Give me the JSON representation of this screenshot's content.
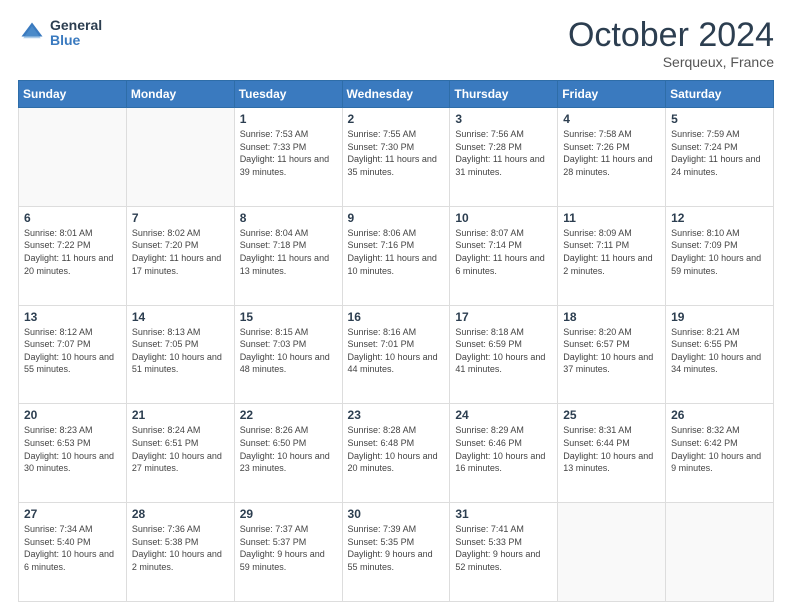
{
  "header": {
    "logo_line1": "General",
    "logo_line2": "Blue",
    "month": "October 2024",
    "location": "Serqueux, France"
  },
  "days_of_week": [
    "Sunday",
    "Monday",
    "Tuesday",
    "Wednesday",
    "Thursday",
    "Friday",
    "Saturday"
  ],
  "weeks": [
    [
      {
        "day": "",
        "sunrise": "",
        "sunset": "",
        "daylight": "",
        "empty": true
      },
      {
        "day": "",
        "sunrise": "",
        "sunset": "",
        "daylight": "",
        "empty": true
      },
      {
        "day": "1",
        "sunrise": "Sunrise: 7:53 AM",
        "sunset": "Sunset: 7:33 PM",
        "daylight": "Daylight: 11 hours and 39 minutes."
      },
      {
        "day": "2",
        "sunrise": "Sunrise: 7:55 AM",
        "sunset": "Sunset: 7:30 PM",
        "daylight": "Daylight: 11 hours and 35 minutes."
      },
      {
        "day": "3",
        "sunrise": "Sunrise: 7:56 AM",
        "sunset": "Sunset: 7:28 PM",
        "daylight": "Daylight: 11 hours and 31 minutes."
      },
      {
        "day": "4",
        "sunrise": "Sunrise: 7:58 AM",
        "sunset": "Sunset: 7:26 PM",
        "daylight": "Daylight: 11 hours and 28 minutes."
      },
      {
        "day": "5",
        "sunrise": "Sunrise: 7:59 AM",
        "sunset": "Sunset: 7:24 PM",
        "daylight": "Daylight: 11 hours and 24 minutes."
      }
    ],
    [
      {
        "day": "6",
        "sunrise": "Sunrise: 8:01 AM",
        "sunset": "Sunset: 7:22 PM",
        "daylight": "Daylight: 11 hours and 20 minutes."
      },
      {
        "day": "7",
        "sunrise": "Sunrise: 8:02 AM",
        "sunset": "Sunset: 7:20 PM",
        "daylight": "Daylight: 11 hours and 17 minutes."
      },
      {
        "day": "8",
        "sunrise": "Sunrise: 8:04 AM",
        "sunset": "Sunset: 7:18 PM",
        "daylight": "Daylight: 11 hours and 13 minutes."
      },
      {
        "day": "9",
        "sunrise": "Sunrise: 8:06 AM",
        "sunset": "Sunset: 7:16 PM",
        "daylight": "Daylight: 11 hours and 10 minutes."
      },
      {
        "day": "10",
        "sunrise": "Sunrise: 8:07 AM",
        "sunset": "Sunset: 7:14 PM",
        "daylight": "Daylight: 11 hours and 6 minutes."
      },
      {
        "day": "11",
        "sunrise": "Sunrise: 8:09 AM",
        "sunset": "Sunset: 7:11 PM",
        "daylight": "Daylight: 11 hours and 2 minutes."
      },
      {
        "day": "12",
        "sunrise": "Sunrise: 8:10 AM",
        "sunset": "Sunset: 7:09 PM",
        "daylight": "Daylight: 10 hours and 59 minutes."
      }
    ],
    [
      {
        "day": "13",
        "sunrise": "Sunrise: 8:12 AM",
        "sunset": "Sunset: 7:07 PM",
        "daylight": "Daylight: 10 hours and 55 minutes."
      },
      {
        "day": "14",
        "sunrise": "Sunrise: 8:13 AM",
        "sunset": "Sunset: 7:05 PM",
        "daylight": "Daylight: 10 hours and 51 minutes."
      },
      {
        "day": "15",
        "sunrise": "Sunrise: 8:15 AM",
        "sunset": "Sunset: 7:03 PM",
        "daylight": "Daylight: 10 hours and 48 minutes."
      },
      {
        "day": "16",
        "sunrise": "Sunrise: 8:16 AM",
        "sunset": "Sunset: 7:01 PM",
        "daylight": "Daylight: 10 hours and 44 minutes."
      },
      {
        "day": "17",
        "sunrise": "Sunrise: 8:18 AM",
        "sunset": "Sunset: 6:59 PM",
        "daylight": "Daylight: 10 hours and 41 minutes."
      },
      {
        "day": "18",
        "sunrise": "Sunrise: 8:20 AM",
        "sunset": "Sunset: 6:57 PM",
        "daylight": "Daylight: 10 hours and 37 minutes."
      },
      {
        "day": "19",
        "sunrise": "Sunrise: 8:21 AM",
        "sunset": "Sunset: 6:55 PM",
        "daylight": "Daylight: 10 hours and 34 minutes."
      }
    ],
    [
      {
        "day": "20",
        "sunrise": "Sunrise: 8:23 AM",
        "sunset": "Sunset: 6:53 PM",
        "daylight": "Daylight: 10 hours and 30 minutes."
      },
      {
        "day": "21",
        "sunrise": "Sunrise: 8:24 AM",
        "sunset": "Sunset: 6:51 PM",
        "daylight": "Daylight: 10 hours and 27 minutes."
      },
      {
        "day": "22",
        "sunrise": "Sunrise: 8:26 AM",
        "sunset": "Sunset: 6:50 PM",
        "daylight": "Daylight: 10 hours and 23 minutes."
      },
      {
        "day": "23",
        "sunrise": "Sunrise: 8:28 AM",
        "sunset": "Sunset: 6:48 PM",
        "daylight": "Daylight: 10 hours and 20 minutes."
      },
      {
        "day": "24",
        "sunrise": "Sunrise: 8:29 AM",
        "sunset": "Sunset: 6:46 PM",
        "daylight": "Daylight: 10 hours and 16 minutes."
      },
      {
        "day": "25",
        "sunrise": "Sunrise: 8:31 AM",
        "sunset": "Sunset: 6:44 PM",
        "daylight": "Daylight: 10 hours and 13 minutes."
      },
      {
        "day": "26",
        "sunrise": "Sunrise: 8:32 AM",
        "sunset": "Sunset: 6:42 PM",
        "daylight": "Daylight: 10 hours and 9 minutes."
      }
    ],
    [
      {
        "day": "27",
        "sunrise": "Sunrise: 7:34 AM",
        "sunset": "Sunset: 5:40 PM",
        "daylight": "Daylight: 10 hours and 6 minutes."
      },
      {
        "day": "28",
        "sunrise": "Sunrise: 7:36 AM",
        "sunset": "Sunset: 5:38 PM",
        "daylight": "Daylight: 10 hours and 2 minutes."
      },
      {
        "day": "29",
        "sunrise": "Sunrise: 7:37 AM",
        "sunset": "Sunset: 5:37 PM",
        "daylight": "Daylight: 9 hours and 59 minutes."
      },
      {
        "day": "30",
        "sunrise": "Sunrise: 7:39 AM",
        "sunset": "Sunset: 5:35 PM",
        "daylight": "Daylight: 9 hours and 55 minutes."
      },
      {
        "day": "31",
        "sunrise": "Sunrise: 7:41 AM",
        "sunset": "Sunset: 5:33 PM",
        "daylight": "Daylight: 9 hours and 52 minutes."
      },
      {
        "day": "",
        "sunrise": "",
        "sunset": "",
        "daylight": "",
        "empty": true
      },
      {
        "day": "",
        "sunrise": "",
        "sunset": "",
        "daylight": "",
        "empty": true
      }
    ]
  ]
}
